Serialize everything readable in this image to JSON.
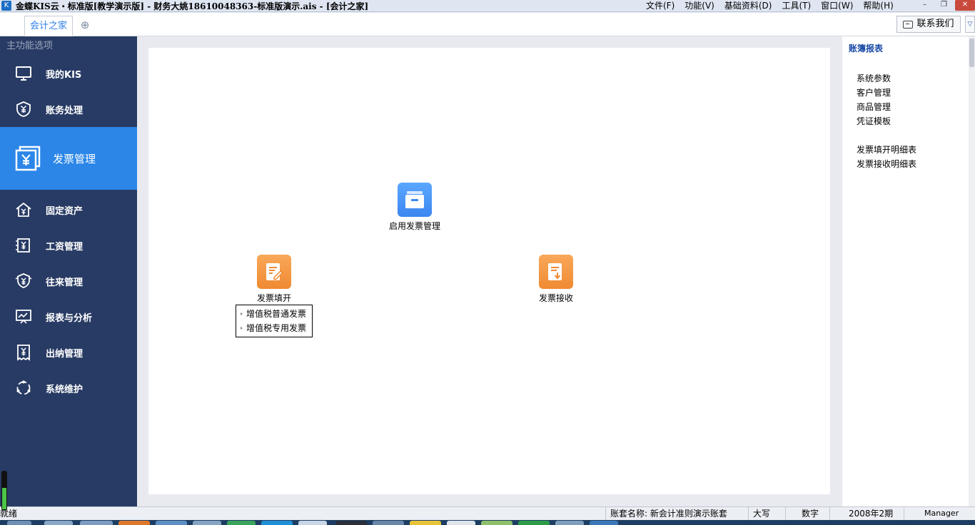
{
  "window": {
    "title": "金蝶KIS云・标准版[教学演示版] - 财务大姚18610048363-标准版演示.ais - [会计之家]",
    "menus": [
      "文件(F)",
      "功能(V)",
      "基础资料(D)",
      "工具(T)",
      "窗口(W)",
      "帮助(H)"
    ],
    "controls": {
      "minimize": "–",
      "restore": "❐",
      "close": "✕"
    }
  },
  "tabs": {
    "active": "会计之家",
    "add_icon": "plus-icon",
    "contact_label": "联系我们"
  },
  "sidebar": {
    "header": "主功能选项",
    "items": [
      {
        "label": "我的KIS",
        "icon": "monitor-icon"
      },
      {
        "label": "账务处理",
        "icon": "yuan-shield-icon"
      },
      {
        "label": "发票管理",
        "icon": "invoice-icon",
        "active": true
      },
      {
        "label": "固定资产",
        "icon": "house-yuan-icon"
      },
      {
        "label": "工资管理",
        "icon": "payroll-icon"
      },
      {
        "label": "往来管理",
        "icon": "exchange-icon"
      },
      {
        "label": "报表与分析",
        "icon": "chart-board-icon"
      },
      {
        "label": "出纳管理",
        "icon": "cashier-icon"
      },
      {
        "label": "系统维护",
        "icon": "cycle-icon"
      }
    ]
  },
  "canvas": {
    "enable_node": "启用发票管理",
    "issue_node": "发票填开",
    "receive_node": "发票接收",
    "issue_submenu": [
      "增值税普通发票",
      "增值税专用发票"
    ]
  },
  "right_panel": {
    "title": "账簿报表",
    "group1": [
      "系统参数",
      "客户管理",
      "商品管理",
      "凭证模板"
    ],
    "group2": [
      "发票填开明细表",
      "发票接收明细表"
    ]
  },
  "status": {
    "left": "就绪",
    "account": "账套名称: 新会计准则演示账套",
    "caps": "大写",
    "num": "数字",
    "period": "2008年2期",
    "user": "Manager"
  },
  "colors": {
    "sidebar_bg": "#283b64",
    "sidebar_active": "#2b86e8",
    "accent_link": "#1a4aa8",
    "node_blue": "#3c86f0",
    "node_orange": "#ef8a32"
  }
}
